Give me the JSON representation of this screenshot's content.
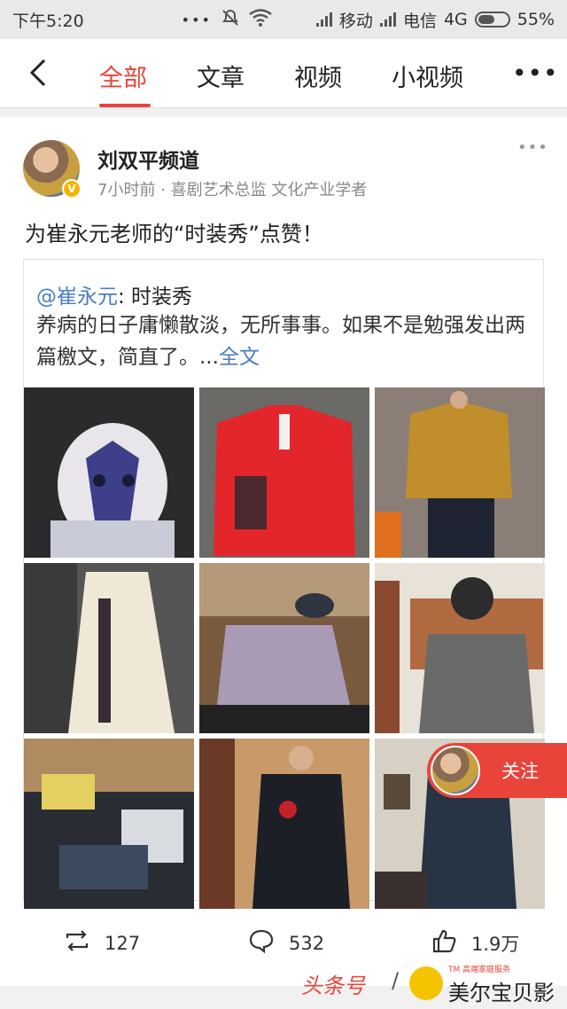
{
  "status_bar": {
    "time": "下午5:20",
    "more": "•••",
    "carrier1": "移动",
    "carrier2": "电信",
    "network": "4G",
    "battery": "55%"
  },
  "nav": {
    "tabs": [
      "全部",
      "文章",
      "视频",
      "小视频"
    ],
    "active_index": 0,
    "more": "•••"
  },
  "post": {
    "author": "刘双平频道",
    "meta": "7小时前 · 喜剧艺术总监 文化产业学者",
    "text": "为崔永元老师的“时装秀”点赞！",
    "more": "•••",
    "quote": {
      "mention": "@崔永元",
      "title_sep": ": 时装秀",
      "body": "养病的日子庸懒散淡，无所事事。如果不是勉强发出两篇檄文，简直了。...",
      "read_more": "全文"
    },
    "follow_label": "关注",
    "actions": {
      "repost": "127",
      "comment": "532",
      "like": "1.9万"
    }
  },
  "watermark": {
    "part1": "头条号",
    "part2": "/",
    "part3": "美尔宝贝影视娱乐",
    "part4": "TM 高端家庭服务"
  },
  "colors": {
    "accent": "#e8443a",
    "link": "#4a7dc0"
  }
}
